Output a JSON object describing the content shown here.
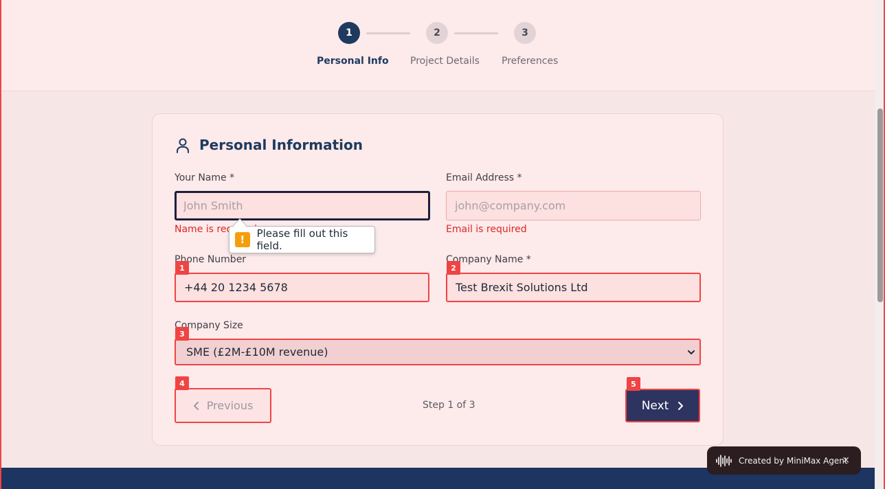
{
  "stepper": {
    "steps": [
      {
        "number": "1",
        "label": "Personal Info",
        "state": "active"
      },
      {
        "number": "2",
        "label": "Project Details",
        "state": "inactive"
      },
      {
        "number": "3",
        "label": "Preferences",
        "state": "inactive"
      }
    ]
  },
  "card": {
    "title": "Personal Information",
    "title_icon": "user-icon"
  },
  "form": {
    "name": {
      "label": "Your Name *",
      "placeholder": "John Smith",
      "value": "",
      "error": "Name is required"
    },
    "email": {
      "label": "Email Address *",
      "placeholder": "john@company.com",
      "value": "",
      "error": "Email is required"
    },
    "phone": {
      "label": "Phone Number",
      "value": "+44 20 1234 5678",
      "marker": "1"
    },
    "company": {
      "label": "Company Name *",
      "value": "Test Brexit Solutions Ltd",
      "marker": "2"
    },
    "company_size": {
      "label": "Company Size",
      "value": "SME (£2M-£10M revenue)",
      "marker": "3"
    }
  },
  "nav": {
    "previous_label": "Previous",
    "previous_marker": "4",
    "next_label": "Next",
    "next_marker": "5",
    "step_count": "Step 1 of 3"
  },
  "tooltip": {
    "text": "Please fill out this field.",
    "icon": "warning-icon"
  },
  "badge": {
    "text": "Created by MiniMax Agent",
    "close": "×",
    "icon": "waveform-icon"
  },
  "colors": {
    "primary": "#1e3a5f",
    "error": "#dc2626",
    "marker": "#ef4444",
    "warning": "#f59e0b"
  }
}
